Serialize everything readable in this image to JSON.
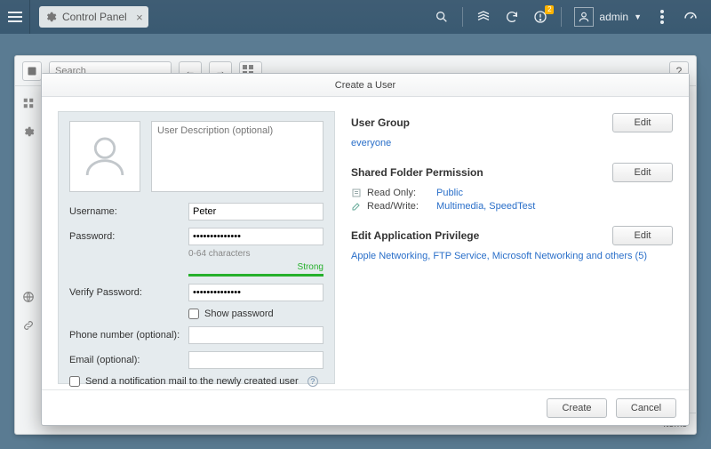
{
  "topbar": {
    "tab": {
      "label": "Control Panel"
    },
    "notifications_badge": "2",
    "user": "admin"
  },
  "panel": {
    "search_placeholder": "Search",
    "footer": "Items"
  },
  "modal": {
    "title": "Create a User",
    "desc_placeholder": "User Description (optional)",
    "labels": {
      "username": "Username:",
      "password": "Password:",
      "verify": "Verify Password:",
      "phone": "Phone number (optional):",
      "email": "Email (optional):",
      "show_password": "Show password",
      "notify": "Send a notification mail to the newly created user",
      "pw_hint": "0-64 characters",
      "strength": "Strong"
    },
    "values": {
      "username": "Peter",
      "password": "••••••••••••••",
      "verify": "••••••••••••••"
    },
    "buttons": {
      "create": "Create",
      "cancel": "Cancel",
      "edit": "Edit"
    }
  },
  "right": {
    "user_group": {
      "title": "User Group",
      "value": "everyone"
    },
    "shared": {
      "title": "Shared Folder Permission",
      "readonly_label": "Read Only:",
      "readonly_value": "Public",
      "readwrite_label": "Read/Write:",
      "readwrite_value": "Multimedia, SpeedTest"
    },
    "app_priv": {
      "title": "Edit Application Privilege",
      "value": "Apple Networking, FTP Service, Microsoft Networking and others (5)"
    }
  }
}
